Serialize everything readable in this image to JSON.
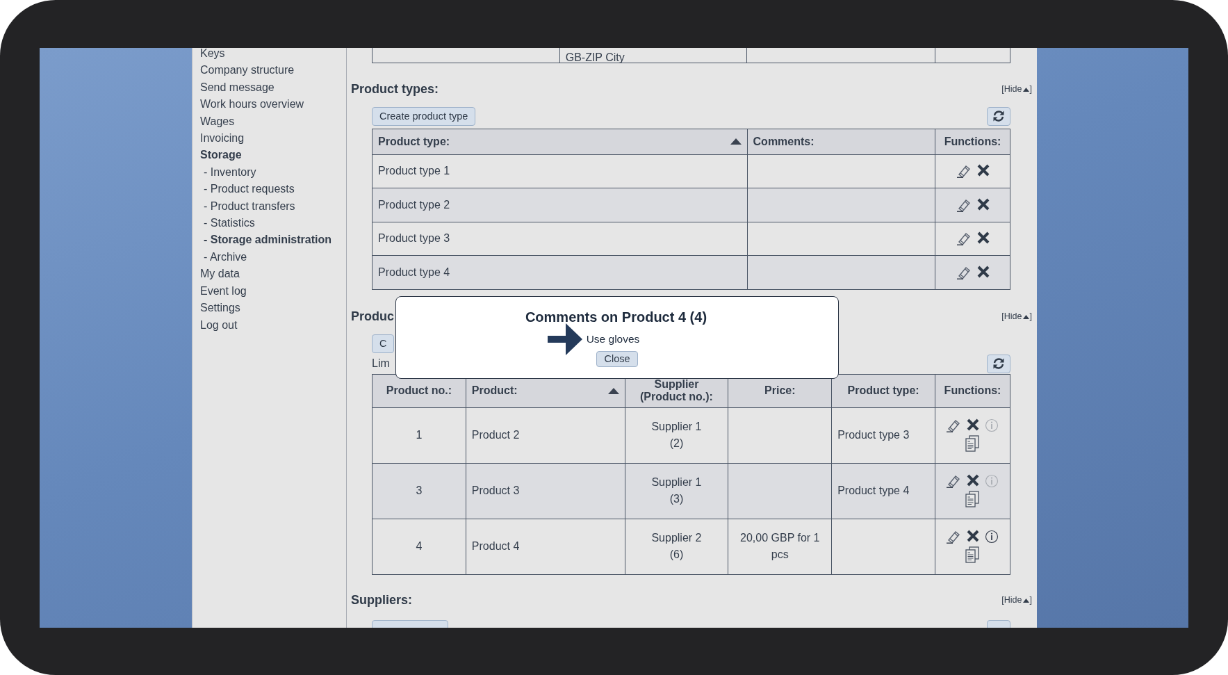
{
  "sidebar": {
    "items": [
      {
        "label": "Keys",
        "selected": false
      },
      {
        "label": "Company structure",
        "selected": false
      },
      {
        "label": "Send message",
        "selected": false
      },
      {
        "label": "Work hours overview",
        "selected": false
      },
      {
        "label": "Wages",
        "selected": false
      },
      {
        "label": "Invoicing",
        "selected": false
      },
      {
        "label": "Storage",
        "expanded": true,
        "children": [
          {
            "label": "- Inventory",
            "selected": false
          },
          {
            "label": "- Product requests",
            "selected": false
          },
          {
            "label": "- Product transfers",
            "selected": false
          },
          {
            "label": "- Statistics",
            "selected": false
          },
          {
            "label": "- Storage administration",
            "selected": true
          },
          {
            "label": "- Archive",
            "selected": false
          }
        ]
      },
      {
        "label": "My data",
        "selected": false
      },
      {
        "label": "Event log",
        "selected": false
      },
      {
        "label": "Settings",
        "selected": false
      },
      {
        "label": "Log out",
        "selected": false
      }
    ]
  },
  "top_table": {
    "row": {
      "column_2": "GB-ZIP City"
    }
  },
  "product_types": {
    "title": "Product types:",
    "hide_label": "[Hide",
    "hide_close": "]",
    "create_button": "Create product type",
    "columns": [
      {
        "label": "Product type:",
        "sorted": true
      },
      {
        "label": "Comments:",
        "sorted": false
      },
      {
        "label": "Functions:",
        "sorted": false
      }
    ],
    "rows": [
      {
        "product_type": "Product type 1"
      },
      {
        "product_type": "Product type 2"
      },
      {
        "product_type": "Product type 3"
      },
      {
        "product_type": "Product type 4"
      }
    ]
  },
  "products": {
    "title": "Produc",
    "hide_label": "[Hide",
    "hide_close": "]",
    "create_button": "C",
    "limit_text": "Lim",
    "columns": [
      {
        "label": "Product no.:",
        "sorted": false
      },
      {
        "label": "Product:",
        "sorted": true
      },
      {
        "label": "Supplier (Product no.):",
        "sorted": false
      },
      {
        "label": "Price:",
        "sorted": false
      },
      {
        "label": "Product type:",
        "sorted": false
      },
      {
        "label": "Functions:",
        "sorted": false
      }
    ],
    "rows": [
      {
        "product_no": "1",
        "product": "Product 2",
        "supplier": "Supplier 1",
        "supplier_product_no": "(2)",
        "product_type": "Product type 3",
        "has_comments": false
      },
      {
        "product_no": "3",
        "product": "Product 3",
        "supplier": "Supplier 1",
        "supplier_product_no": "(3)",
        "product_type": "Product type 4",
        "has_comments": false
      },
      {
        "product_no": "4",
        "product": "Product 4",
        "supplier": "Supplier 2",
        "supplier_product_no": "(6)",
        "price": "20,00 GBP for 1 pcs",
        "has_comments": true
      }
    ]
  },
  "suppliers": {
    "title": "Suppliers:",
    "hide_label": "[Hide",
    "hide_close": "]"
  },
  "dialog": {
    "title": "Comments on Product 4 (4)",
    "comment": "Use gloves",
    "close_button": "Close"
  }
}
